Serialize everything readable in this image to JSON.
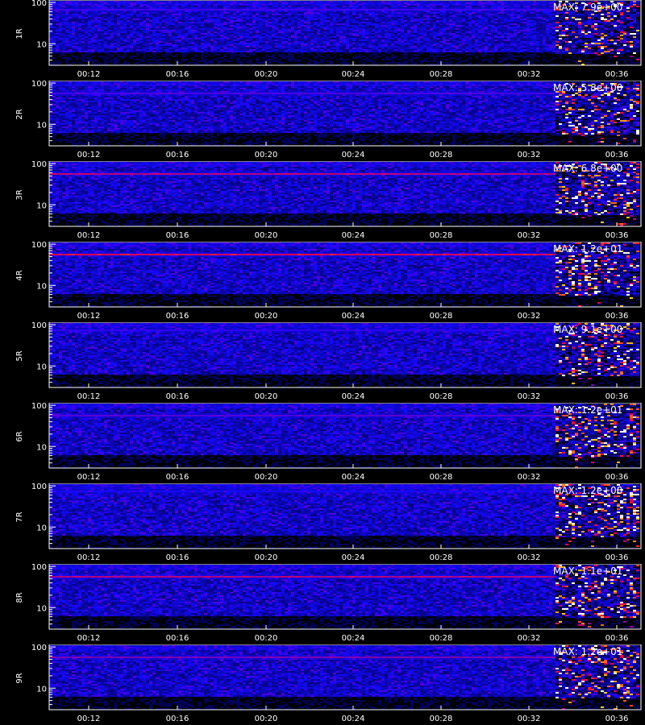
{
  "chart_data": {
    "type": "heatmap",
    "x_tick_labels": [
      "00:12",
      "00:16",
      "00:20",
      "00:24",
      "00:28",
      "00:32",
      "00:36"
    ],
    "y_scale": "log",
    "y_tick_labels": [
      "10",
      "100"
    ],
    "y_range": [
      3,
      110
    ],
    "colormap": [
      "#000000",
      "#0000ff",
      "#ff0000",
      "#ffff00",
      "#ffffff"
    ],
    "panels": [
      {
        "detector": "1R",
        "max_text": "MAX: 7.9e+00",
        "max": 7.9,
        "line_energy": 70,
        "line_strength": 0.25,
        "burst_start_fraction": 0.86
      },
      {
        "detector": "2R",
        "max_text": "MAX: 5.8e+00",
        "max": 5.8,
        "line_energy": 60,
        "line_strength": 0.3,
        "burst_start_fraction": 0.86
      },
      {
        "detector": "3R",
        "max_text": "MAX: 6.8e+00",
        "max": 6.8,
        "line_energy": 60,
        "line_strength": 0.75,
        "burst_start_fraction": 0.86
      },
      {
        "detector": "4R",
        "max_text": "MAX: 1.2e+01",
        "max": 12,
        "line_energy": 60,
        "line_strength": 0.95,
        "burst_start_fraction": 0.86
      },
      {
        "detector": "5R",
        "max_text": "MAX: 9.1e+00",
        "max": 9.1,
        "line_energy": 80,
        "line_strength": 0.2,
        "burst_start_fraction": 0.86
      },
      {
        "detector": "6R",
        "max_text": "MAX: 1.2e+01",
        "max": 12,
        "line_energy": 60,
        "line_strength": 0.35,
        "burst_start_fraction": 0.86
      },
      {
        "detector": "7R",
        "max_text": "MAX: 1.2e+00",
        "max": 1.2,
        "line_energy": 80,
        "line_strength": 0.15,
        "burst_start_fraction": 0.86
      },
      {
        "detector": "8R",
        "max_text": "MAX: 1.1e+01",
        "max": 11,
        "line_energy": 60,
        "line_strength": 0.7,
        "burst_start_fraction": 0.86
      },
      {
        "detector": "9R",
        "max_text": "MAX: 1.2e+01",
        "max": 12,
        "line_energy": 60,
        "line_strength": 0.5,
        "burst_start_fraction": 0.86
      }
    ]
  }
}
